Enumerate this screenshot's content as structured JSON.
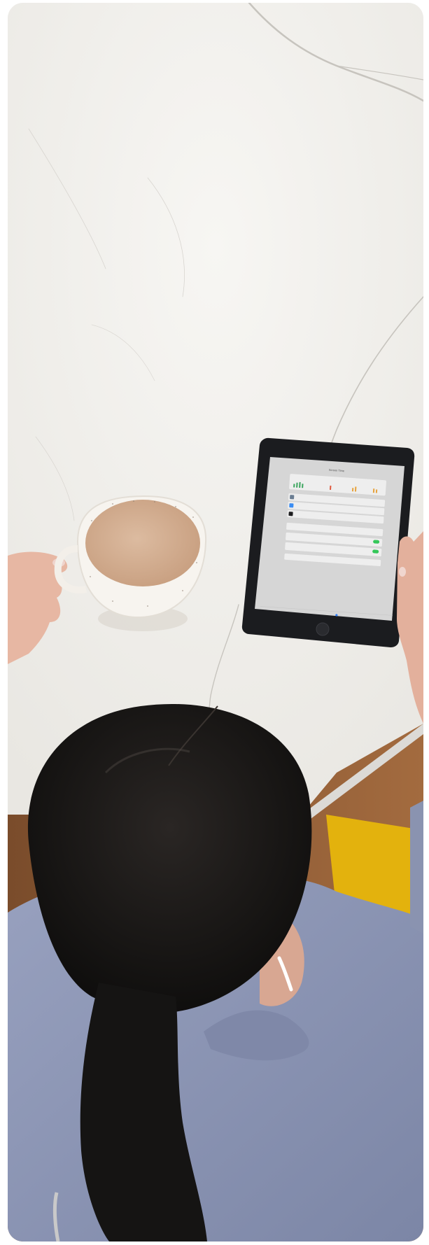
{
  "scene": {
    "description_free": true,
    "colors": {
      "marble": "#f1f0ec",
      "marble_vein": "#c9c6c0",
      "coffee": "#d6b397",
      "cup": "#f6f3ee",
      "tablet_frame": "#1b1c1f",
      "tablet_screen": "#d8d8d8",
      "hair": "#141312",
      "sweater": "#8e97b5",
      "skin": "#e8b9a6",
      "chair_yellow": "#e6b80f",
      "floor": "#8a5a35"
    }
  },
  "tablet_ui": {
    "title": "Screen Time",
    "toggle_color": "#34c759",
    "accent": "#2f7df6",
    "tab_bar": {
      "active_color": "#2f7df6"
    }
  }
}
